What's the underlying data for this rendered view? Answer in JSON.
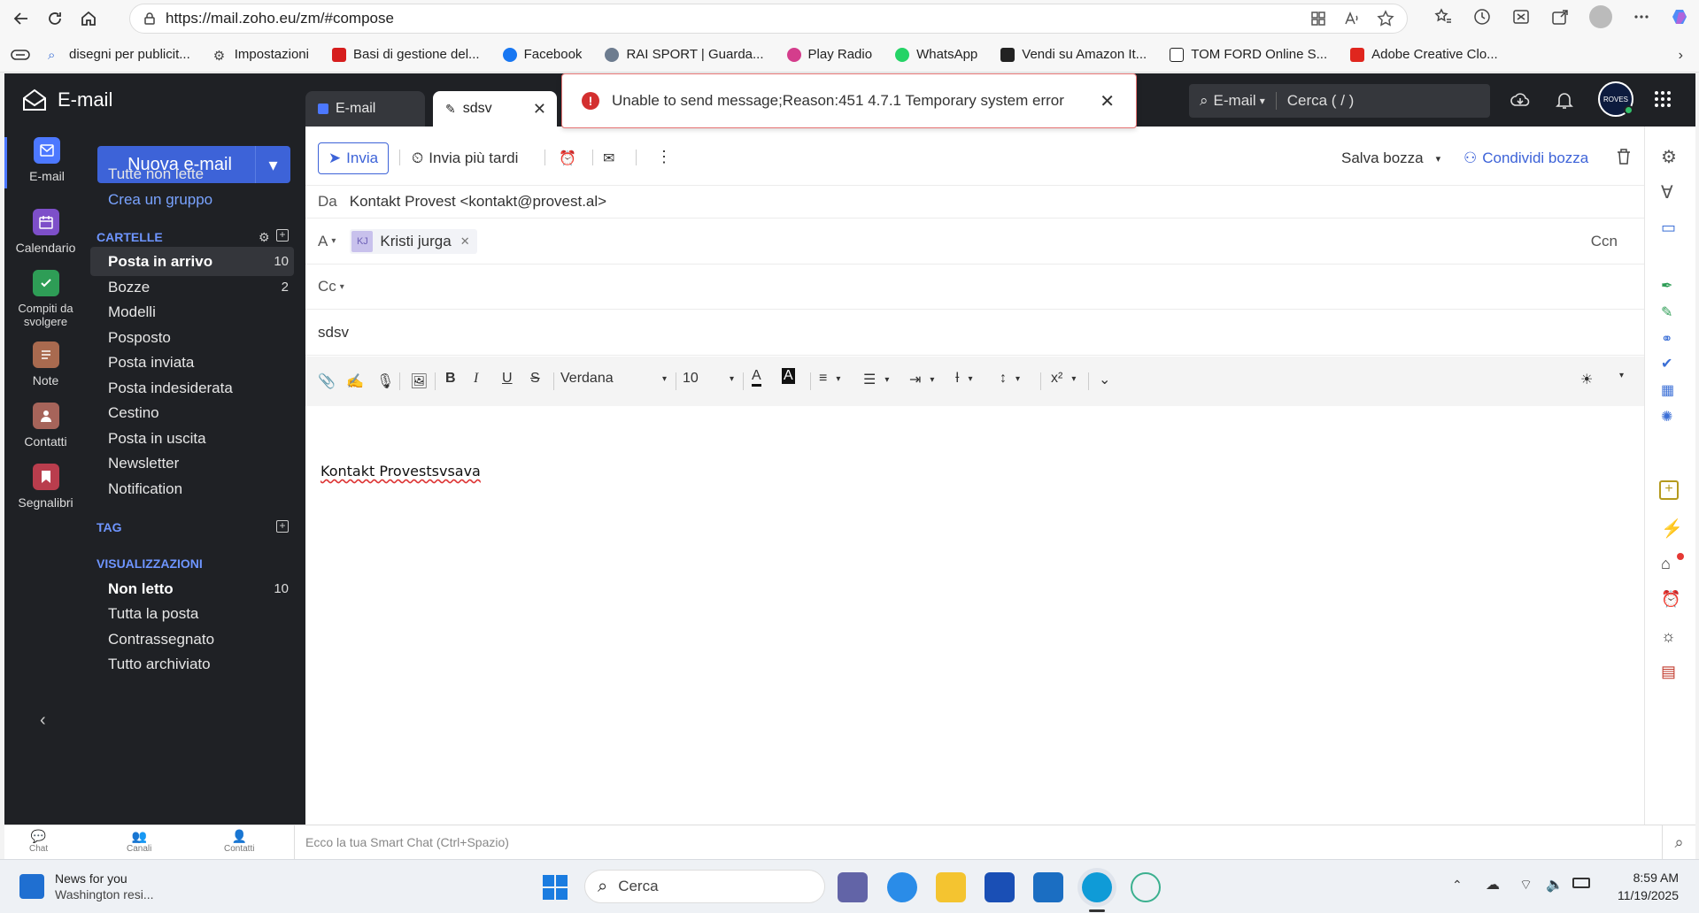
{
  "browser": {
    "url": "https://mail.zoho.eu/zm/#compose",
    "bookmarks": [
      "disegni per publicit...",
      "Impostazioni",
      "Basi di gestione del...",
      "Facebook",
      "RAI SPORT | Guarda...",
      "Play Radio",
      "WhatsApp",
      "Vendi su Amazon It...",
      "TOM FORD Online S...",
      "Adobe Creative Clo..."
    ]
  },
  "app": {
    "logo_text": "E-mail",
    "tabs": [
      "E-mail",
      "sdsv"
    ],
    "search_scope": "E-mail",
    "search_placeholder": "Cerca ( / )",
    "avatar_text": "ROVES"
  },
  "rail": {
    "items": [
      "E-mail",
      "Calendario",
      "Compiti da svolgere",
      "Note",
      "Contatti",
      "Segnalibri"
    ]
  },
  "sidebar": {
    "new_mail": "Nuova e-mail",
    "all_unread": "Tutte non lette",
    "create_group": "Crea un gruppo",
    "folders_header": "CARTELLE",
    "folders": [
      {
        "name": "Posta in arrivo",
        "count": "10"
      },
      {
        "name": "Bozze",
        "count": "2"
      },
      {
        "name": "Modelli",
        "count": ""
      },
      {
        "name": "Posposto",
        "count": ""
      },
      {
        "name": "Posta inviata",
        "count": ""
      },
      {
        "name": "Posta indesiderata",
        "count": ""
      },
      {
        "name": "Cestino",
        "count": ""
      },
      {
        "name": "Posta in uscita",
        "count": ""
      },
      {
        "name": "Newsletter",
        "count": ""
      },
      {
        "name": "Notification",
        "count": ""
      }
    ],
    "tag_header": "TAG",
    "views_header": "VISUALIZZAZIONI",
    "views": [
      {
        "name": "Non letto",
        "count": "10"
      },
      {
        "name": "Tutta la posta",
        "count": ""
      },
      {
        "name": "Contrassegnato",
        "count": ""
      },
      {
        "name": "Tutto archiviato",
        "count": ""
      }
    ]
  },
  "compose": {
    "send": "Invia",
    "send_later": "Invia più tardi",
    "save_draft": "Salva bozza",
    "share_draft": "Condividi bozza",
    "from_label": "Da",
    "from_value": "Kontakt Provest <kontakt@provest.al>",
    "to_label": "A",
    "recipient_initials": "KJ",
    "recipient_name": "Kristi jurga",
    "bcc_label": "Ccn",
    "cc_label": "Cc",
    "subject": "sdsv",
    "font": "Verdana",
    "font_size": "10",
    "body": "Kontakt Provestsvsava"
  },
  "toast": {
    "message": "Unable to send message;Reason:451 4.7.1 Temporary system error"
  },
  "bottom": {
    "chat": "Chat",
    "channels": "Canali",
    "contacts": "Contatti",
    "smartchat_placeholder": "Ecco la tua Smart Chat (Ctrl+Spazio)"
  },
  "taskbar": {
    "news_title": "News for you",
    "news_sub": "Washington resi...",
    "search": "Cerca",
    "time": "8:59 AM",
    "date": "11/19/2025"
  }
}
